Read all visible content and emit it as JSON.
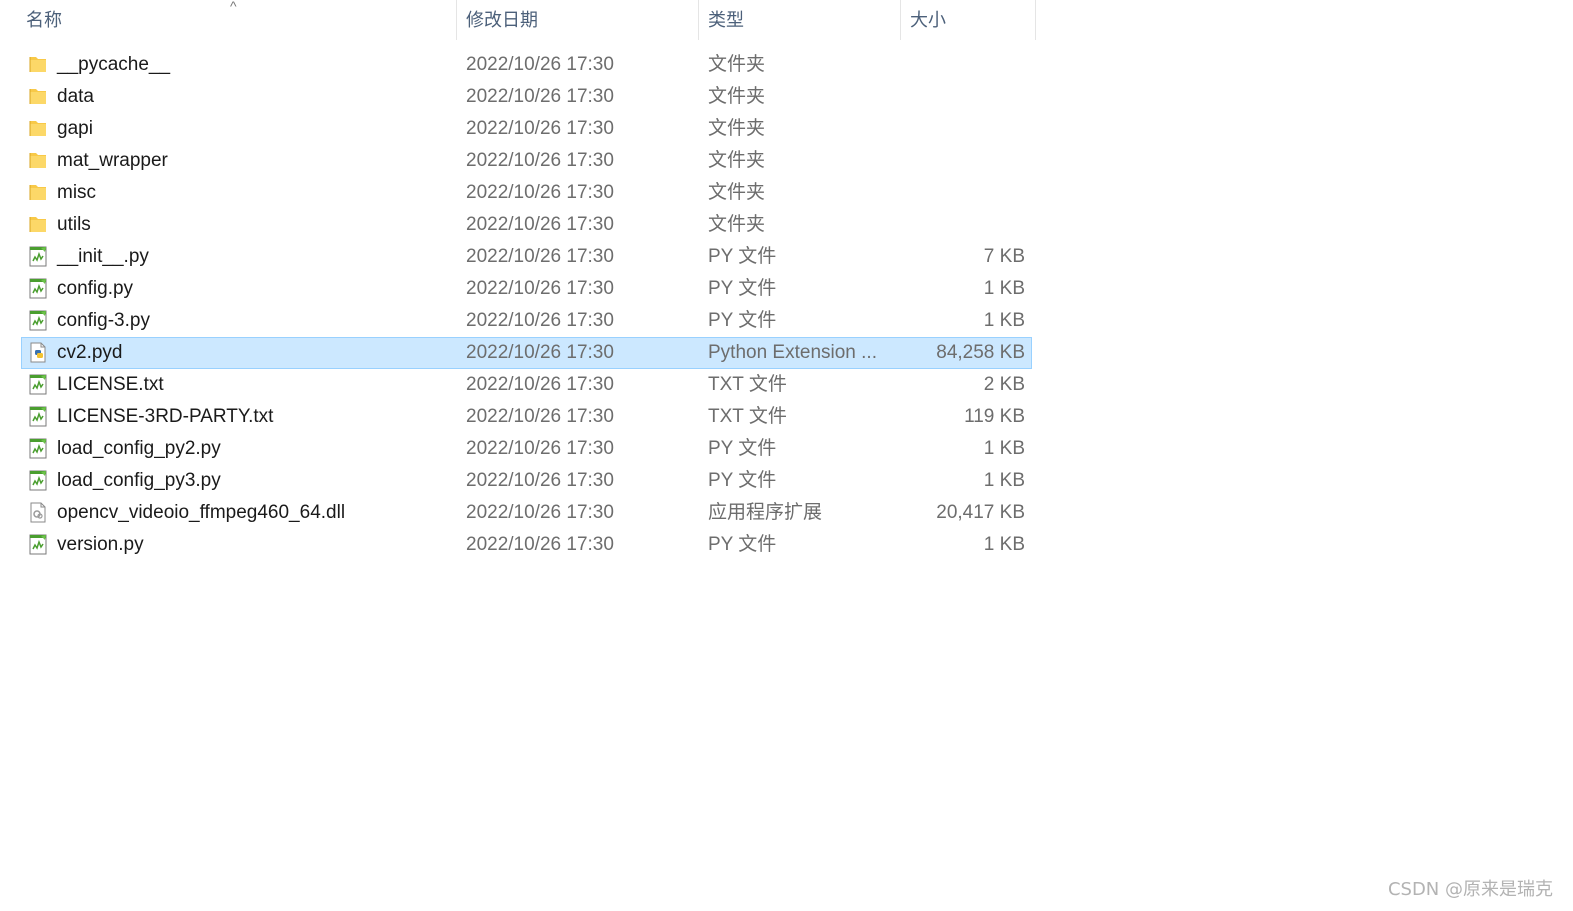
{
  "header": {
    "name_label": "名称",
    "date_label": "修改日期",
    "type_label": "类型",
    "size_label": "大小",
    "sort_indicator": "^"
  },
  "files": [
    {
      "name": "__pycache__",
      "date": "2022/10/26 17:30",
      "type": "文件夹",
      "size": "",
      "icon": "folder-icon"
    },
    {
      "name": "data",
      "date": "2022/10/26 17:30",
      "type": "文件夹",
      "size": "",
      "icon": "folder-icon"
    },
    {
      "name": "gapi",
      "date": "2022/10/26 17:30",
      "type": "文件夹",
      "size": "",
      "icon": "folder-icon"
    },
    {
      "name": "mat_wrapper",
      "date": "2022/10/26 17:30",
      "type": "文件夹",
      "size": "",
      "icon": "folder-icon"
    },
    {
      "name": "misc",
      "date": "2022/10/26 17:30",
      "type": "文件夹",
      "size": "",
      "icon": "folder-icon"
    },
    {
      "name": "utils",
      "date": "2022/10/26 17:30",
      "type": "文件夹",
      "size": "",
      "icon": "folder-icon"
    },
    {
      "name": "__init__.py",
      "date": "2022/10/26 17:30",
      "type": "PY 文件",
      "size": "7 KB",
      "icon": "script-file-icon"
    },
    {
      "name": "config.py",
      "date": "2022/10/26 17:30",
      "type": "PY 文件",
      "size": "1 KB",
      "icon": "script-file-icon"
    },
    {
      "name": "config-3.py",
      "date": "2022/10/26 17:30",
      "type": "PY 文件",
      "size": "1 KB",
      "icon": "script-file-icon"
    },
    {
      "name": "cv2.pyd",
      "date": "2022/10/26 17:30",
      "type": "Python Extension ...",
      "size": "84,258 KB",
      "icon": "python-extension-icon",
      "selected": true
    },
    {
      "name": "LICENSE.txt",
      "date": "2022/10/26 17:30",
      "type": "TXT 文件",
      "size": "2 KB",
      "icon": "script-file-icon"
    },
    {
      "name": "LICENSE-3RD-PARTY.txt",
      "date": "2022/10/26 17:30",
      "type": "TXT 文件",
      "size": "119 KB",
      "icon": "script-file-icon"
    },
    {
      "name": "load_config_py2.py",
      "date": "2022/10/26 17:30",
      "type": "PY 文件",
      "size": "1 KB",
      "icon": "script-file-icon"
    },
    {
      "name": "load_config_py3.py",
      "date": "2022/10/26 17:30",
      "type": "PY 文件",
      "size": "1 KB",
      "icon": "script-file-icon"
    },
    {
      "name": "opencv_videoio_ffmpeg460_64.dll",
      "date": "2022/10/26 17:30",
      "type": "应用程序扩展",
      "size": "20,417 KB",
      "icon": "dll-file-icon"
    },
    {
      "name": "version.py",
      "date": "2022/10/26 17:30",
      "type": "PY 文件",
      "size": "1 KB",
      "icon": "script-file-icon"
    }
  ],
  "watermark": "CSDN @原来是瑞克",
  "colors": {
    "selection_bg": "#cce8ff",
    "selection_border": "#99d1ff",
    "header_text": "#4c607a",
    "folder_yellow": "#f8c948",
    "script_green": "#4a9e2f"
  }
}
